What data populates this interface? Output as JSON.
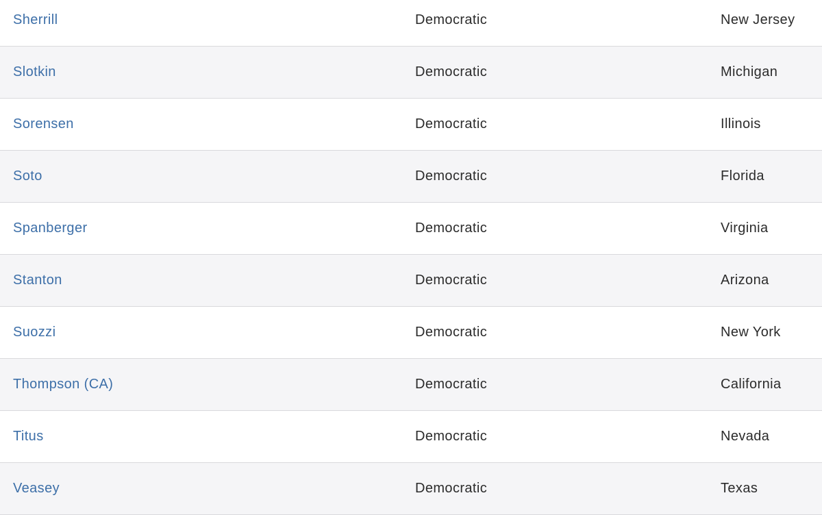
{
  "table": {
    "rows": [
      {
        "name": "Sherrill",
        "party": "Democratic",
        "state": "New Jersey"
      },
      {
        "name": "Slotkin",
        "party": "Democratic",
        "state": "Michigan"
      },
      {
        "name": "Sorensen",
        "party": "Democratic",
        "state": "Illinois"
      },
      {
        "name": "Soto",
        "party": "Democratic",
        "state": "Florida"
      },
      {
        "name": "Spanberger",
        "party": "Democratic",
        "state": "Virginia"
      },
      {
        "name": "Stanton",
        "party": "Democratic",
        "state": "Arizona"
      },
      {
        "name": "Suozzi",
        "party": "Democratic",
        "state": "New York"
      },
      {
        "name": "Thompson (CA)",
        "party": "Democratic",
        "state": "California"
      },
      {
        "name": "Titus",
        "party": "Democratic",
        "state": "Nevada"
      },
      {
        "name": "Veasey",
        "party": "Democratic",
        "state": "Texas"
      }
    ]
  }
}
